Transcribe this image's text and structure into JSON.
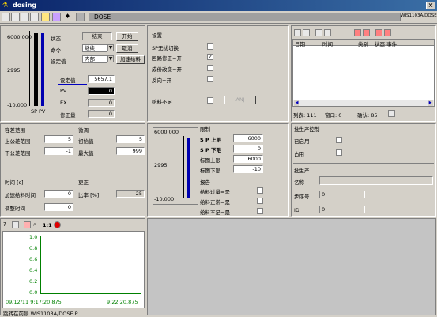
{
  "window": {
    "title": "dosing",
    "close": "×"
  },
  "toolbar": {
    "tab_title": "DOSE",
    "right_label": "WIS1103A/DOSE"
  },
  "status": {
    "state_label": "状态",
    "state_value": "结束",
    "start_btn": "开始",
    "cmd_label": "命令",
    "cmd_value": "继续",
    "cancel_btn": "取消",
    "setval_label": "设定值",
    "setval_value": "内部",
    "accel_btn": "加速给料"
  },
  "gauge": {
    "top": "6000.000",
    "mid": "2995",
    "bottom": "-10.000",
    "sp": "SP",
    "pv": "PV"
  },
  "values": {
    "setpoint_label": "设定值",
    "setpoint": "5657.1",
    "pv_label": "PV",
    "pv": "0",
    "ex_label": "EX",
    "ex": "0",
    "corr_label": "修正量",
    "corr": "0"
  },
  "settings": {
    "title": "设置",
    "items": [
      {
        "label": "SP无扰切换",
        "checked": false
      },
      {
        "label": "回路修正=开",
        "checked": true
      },
      {
        "label": "成份改变=开",
        "checked": false
      },
      {
        "label": "反向=开",
        "checked": false
      }
    ],
    "underfeed_label": "给料不足",
    "underfeed_btn": "ANJ"
  },
  "events": {
    "cols": [
      "日期",
      "时间",
      "类别",
      "状态 事件"
    ],
    "footer_list": "列表: 111",
    "footer_window": "窗口: 0",
    "footer_confirm": "确认:  85"
  },
  "tolerance": {
    "title": "容差范围",
    "upper_label": "上公差范围",
    "upper": "5",
    "lower_label": "下公差范围",
    "lower": "-1",
    "speed_title": "微调",
    "init_label": "初始值",
    "init": "5",
    "max_label": "最大值",
    "max": "999"
  },
  "time": {
    "title": "时间 [s]",
    "accel_label": "加速给料时间",
    "accel": "0",
    "adjust_label": "调整时间",
    "adjust": "0",
    "ratio_title": "更正",
    "ratio_label": "比率 [%]",
    "ratio": "25"
  },
  "limits": {
    "top": "6000.000",
    "mid": "2995",
    "bottom": "-10.000",
    "title": "限制",
    "sp_high_label": "S P 上限",
    "sp_high": "6000",
    "sp_low_label": "S P 下限",
    "sp_low": "0",
    "scale_high_label": "标图上限",
    "scale_high": "6000",
    "scale_low_label": "标图下限",
    "scale_low": "-10",
    "report_title": "报告",
    "reports": [
      {
        "label": "给料过量=是"
      },
      {
        "label": "给料正常=是"
      },
      {
        "label": "给料不足=是"
      }
    ]
  },
  "production": {
    "ctrl_title": "批生产控制",
    "enabled_label": "已启用",
    "occupied_label": "占用",
    "title": "批生产",
    "name_label": "名称",
    "step_label": "步序号",
    "step": "0",
    "id_label": "ID",
    "id": "0"
  },
  "trend": {
    "yticks": [
      "1.0",
      "0.8",
      "0.6",
      "0.4",
      "0.2",
      "0.0"
    ],
    "zoom": "1:1",
    "x_start": "09/12/11  9:17:20.875",
    "x_end": "9:22:20.875",
    "footer": "跳转在前景 WIS1103A/DOSE.P"
  }
}
